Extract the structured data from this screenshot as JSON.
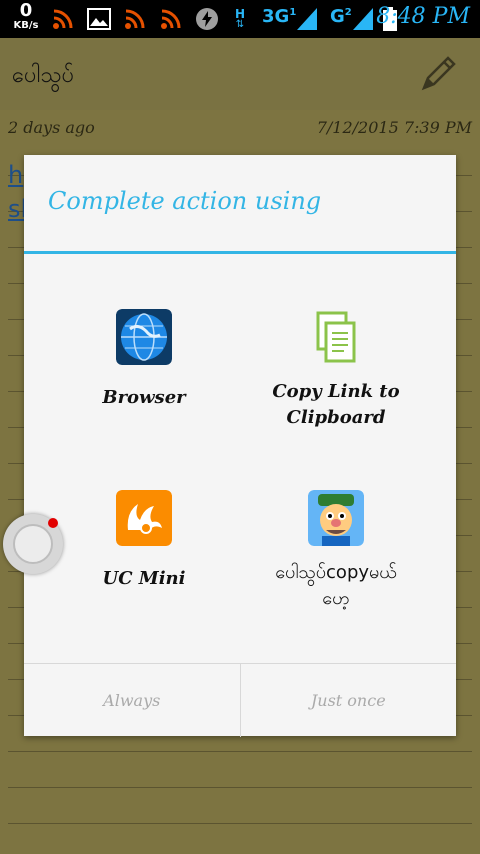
{
  "status_bar": {
    "speed_value": "0",
    "speed_unit": "KB/s",
    "network_1": "3G",
    "network_2": "G",
    "sim1_badge": "1",
    "sim2_badge": "2",
    "h_badge": "H",
    "time": "8:48 PM"
  },
  "app": {
    "title": "ပေါသွပ်",
    "date_relative": "2 days ago",
    "date_full": "7/12/2015 7:39 PM",
    "link_line1": "h",
    "link_line2": "sl"
  },
  "dialog": {
    "title": "Complete action using",
    "apps": [
      {
        "label": "Browser",
        "icon": "browser-icon"
      },
      {
        "label": "Copy Link to Clipboard",
        "icon": "copy-icon"
      },
      {
        "label": "UC Mini",
        "icon": "uc-mini-icon"
      },
      {
        "label": "ပေါသွပ်copyမယ် ဟေ့",
        "icon": "cartoon-app-icon"
      }
    ],
    "always_label": "Always",
    "just_once_label": "Just once"
  },
  "colors": {
    "accent": "#33b5e5",
    "note_bg": "#7d7441",
    "dialog_bg": "#f5f5f5"
  }
}
